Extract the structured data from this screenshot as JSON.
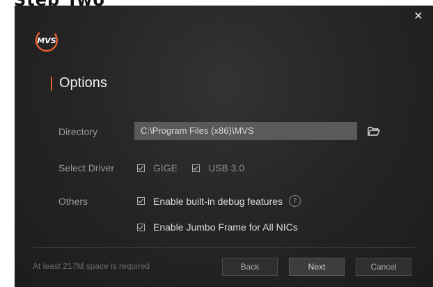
{
  "page": {
    "caption": "Step Two"
  },
  "window": {
    "close_icon": "close-icon"
  },
  "section": {
    "title": "Options"
  },
  "directory": {
    "label": "Directory",
    "value": "C:\\Program Files (x86)\\MVS"
  },
  "driver": {
    "label": "Select Driver",
    "options": [
      {
        "label": "GIGE",
        "checked": true
      },
      {
        "label": "USB 3.0",
        "checked": true
      }
    ]
  },
  "others": {
    "label": "Others",
    "debug_label": "Enable built-in debug features",
    "debug_checked": true,
    "jumbo_label": "Enable Jumbo Frame for All NICs",
    "jumbo_checked": true
  },
  "footer": {
    "note": "At least 217M space is required",
    "back": "Back",
    "next": "Next",
    "cancel": "Cancel"
  },
  "colors": {
    "accent": "#e8612c",
    "background": "#262626"
  },
  "logo": {
    "text": "MVS"
  }
}
